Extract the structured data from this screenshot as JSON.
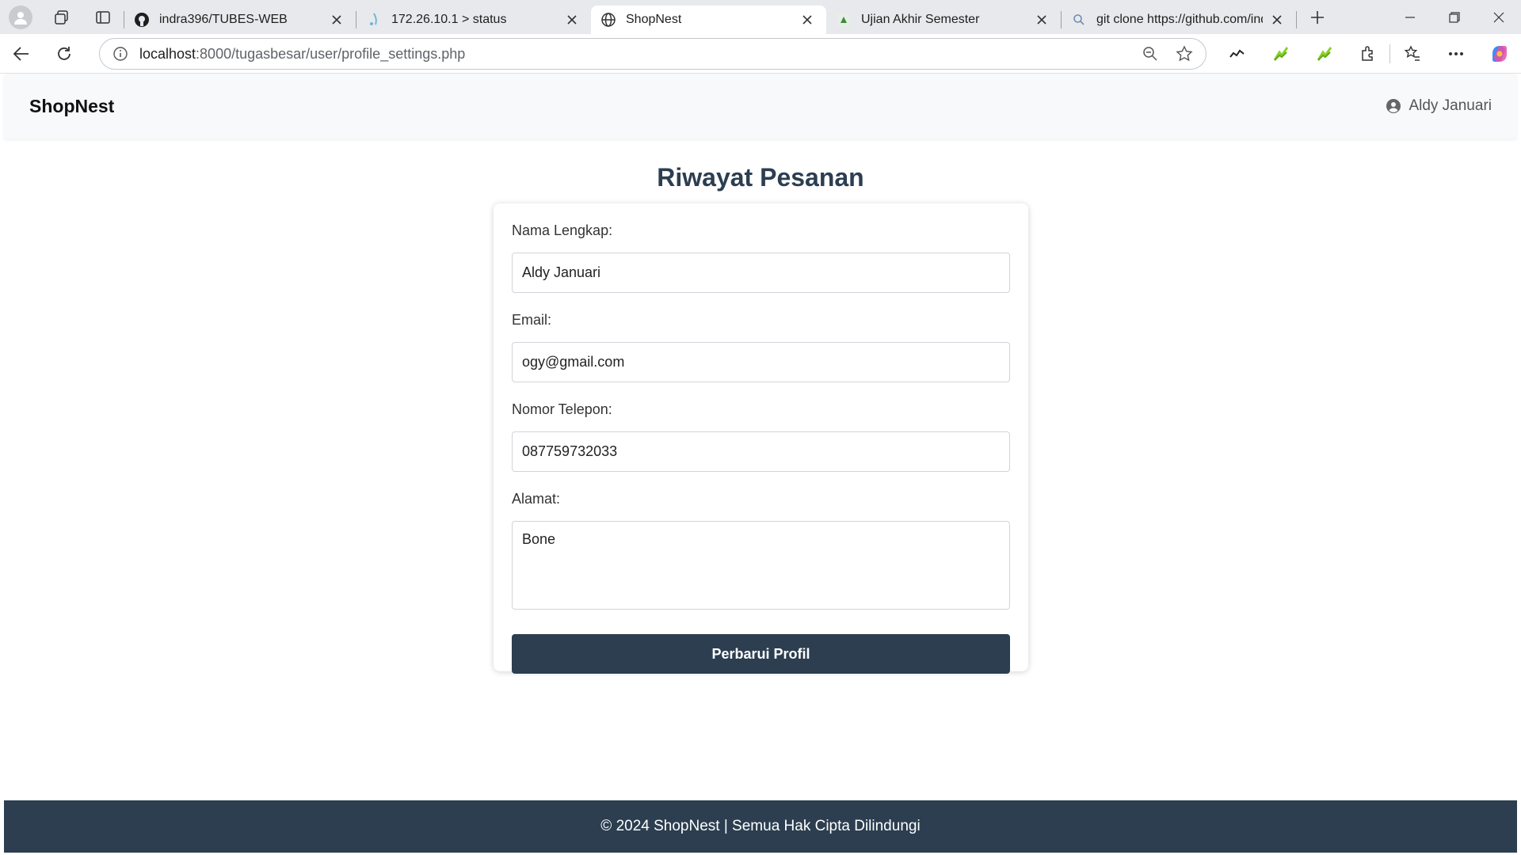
{
  "browser": {
    "tabs": [
      {
        "title": "indra396/TUBES-WEB",
        "icon": "github-icon",
        "active": false
      },
      {
        "title": "172.26.10.1 > status",
        "icon": "status-icon",
        "active": false
      },
      {
        "title": "ShopNest",
        "icon": "globe-icon",
        "active": true
      },
      {
        "title": "Ujian Akhir Semester",
        "icon": "moodle-icon",
        "active": false
      },
      {
        "title": "git clone https://github.com/indr",
        "icon": "search-icon",
        "active": false
      }
    ],
    "url_host": "localhost",
    "url_path": ":8000/tugasbesar/user/profile_settings.php"
  },
  "site": {
    "brand": "ShopNest",
    "user_name": "Aldy Januari"
  },
  "page": {
    "title": "Riwayat Pesanan"
  },
  "form": {
    "name_label": "Nama Lengkap:",
    "name_value": "Aldy Januari",
    "email_label": "Email:",
    "email_value": "ogy@gmail.com",
    "phone_label": "Nomor Telepon:",
    "phone_value": "087759732033",
    "address_label": "Alamat:",
    "address_value": "Bone",
    "submit_label": "Perbarui Profil"
  },
  "footer": {
    "text": "© 2024 ShopNest | Semua Hak Cipta Dilindungi"
  },
  "colors": {
    "primary": "#2c3e50",
    "header_bg": "#f8f9fa"
  }
}
